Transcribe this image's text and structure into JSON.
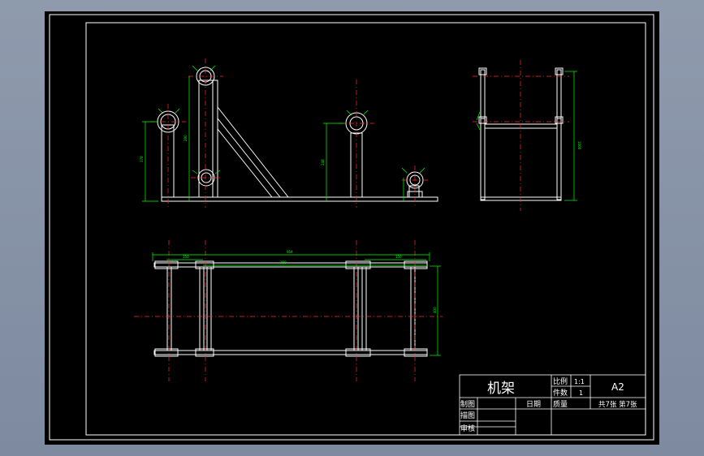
{
  "drawing": {
    "colors": {
      "background": "#000000",
      "geometry": "#ffffff",
      "centerline": "#ff2a2a",
      "dimension": "#00ff00",
      "viewport": "#8c99ab"
    },
    "dimensions": {
      "front_left_height": "378",
      "front_mid_height": "248",
      "front_small_height": "280",
      "top_left_1": "150",
      "top_left_2": "190",
      "top_overall": "954",
      "top_mid": "760",
      "top_right": "150",
      "top_depth": "400",
      "side_height": "1000"
    }
  },
  "title_block": {
    "part_name": "机架",
    "scale_label": "比例",
    "scale_value": "1:1",
    "qty_label": "件数",
    "qty_value": "1",
    "sheet_size": "A2",
    "weight_label": "质量",
    "sheet_count": "共7张 第7张",
    "drawn_label": "制图",
    "traced_label": "描图",
    "checked_label": "审核",
    "date_label": "日期"
  }
}
